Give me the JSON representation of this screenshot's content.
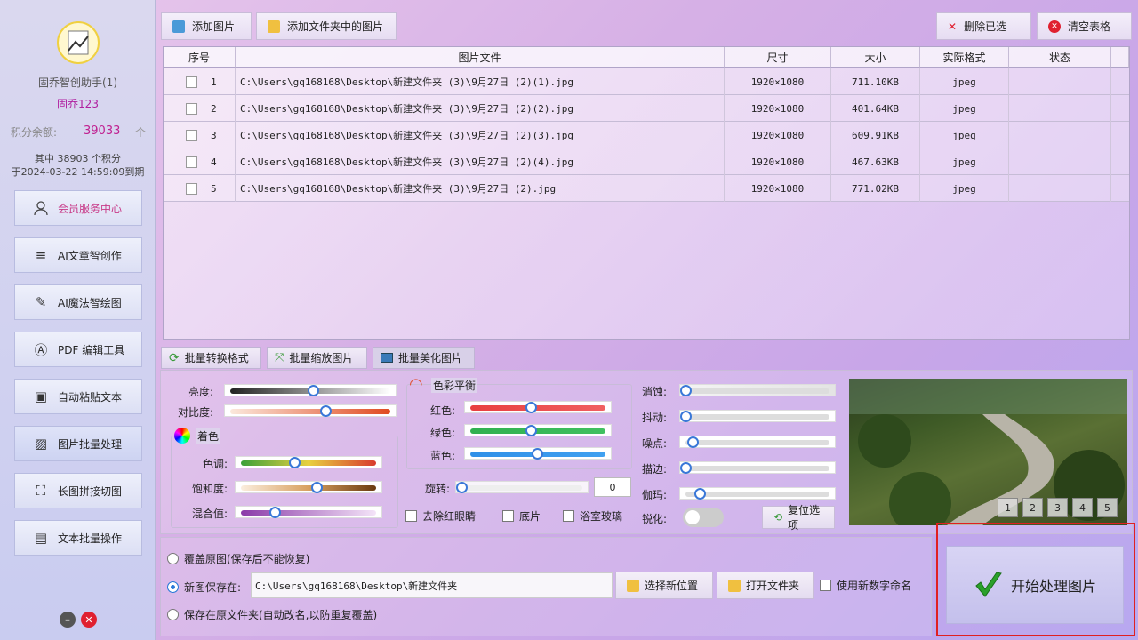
{
  "sidebar": {
    "username": "固乔智创助手(1)",
    "nickname": "固乔123",
    "points_label": "积分余额:",
    "points_value": "39033",
    "points_unit": "个",
    "expire_line1": "其中 38903 个积分",
    "expire_line2": "于2024-03-22 14:59:09到期",
    "member_center": "会员服务中心",
    "menu": [
      "AI文章智创作",
      "AI魔法智绘图",
      "PDF 编辑工具",
      "自动粘贴文本",
      "图片批量处理",
      "长图拼接切图",
      "文本批量操作"
    ]
  },
  "toolbar": {
    "add_image": "添加图片",
    "add_folder": "添加文件夹中的图片",
    "delete_selected": "删除已选",
    "clear_table": "清空表格"
  },
  "table": {
    "headers": [
      "序号",
      "图片文件",
      "尺寸",
      "大小",
      "实际格式",
      "状态"
    ],
    "rows": [
      {
        "idx": "1",
        "file": "C:\\Users\\gq168168\\Desktop\\新建文件夹 (3)\\9月27日 (2)(1).jpg",
        "size": "1920×1080",
        "bytes": "711.10KB",
        "fmt": "jpeg",
        "status": ""
      },
      {
        "idx": "2",
        "file": "C:\\Users\\gq168168\\Desktop\\新建文件夹 (3)\\9月27日 (2)(2).jpg",
        "size": "1920×1080",
        "bytes": "401.64KB",
        "fmt": "jpeg",
        "status": ""
      },
      {
        "idx": "3",
        "file": "C:\\Users\\gq168168\\Desktop\\新建文件夹 (3)\\9月27日 (2)(3).jpg",
        "size": "1920×1080",
        "bytes": "609.91KB",
        "fmt": "jpeg",
        "status": ""
      },
      {
        "idx": "4",
        "file": "C:\\Users\\gq168168\\Desktop\\新建文件夹 (3)\\9月27日 (2)(4).jpg",
        "size": "1920×1080",
        "bytes": "467.63KB",
        "fmt": "jpeg",
        "status": ""
      },
      {
        "idx": "5",
        "file": "C:\\Users\\gq168168\\Desktop\\新建文件夹 (3)\\9月27日 (2).jpg",
        "size": "1920×1080",
        "bytes": "771.02KB",
        "fmt": "jpeg",
        "status": ""
      }
    ]
  },
  "tabs": [
    "批量转换格式",
    "批量缩放图片",
    "批量美化图片"
  ],
  "beautify": {
    "brightness": "亮度:",
    "contrast": "对比度:",
    "tint_group": "着色",
    "hue": "色调:",
    "saturation": "饱和度:",
    "blend": "混合值:",
    "balance_group": "色彩平衡",
    "red": "红色:",
    "green": "绿色:",
    "blue": "蓝色:",
    "rotate": "旋转:",
    "rotate_value": "0",
    "redeye": "去除红眼睛",
    "negative": "底片",
    "frosted": "浴室玻璃",
    "erode": "消蚀:",
    "jitter": "抖动:",
    "noise": "噪点:",
    "edge": "描边:",
    "gamma": "伽玛:",
    "sharpen": "锐化:",
    "reset": "复位选项",
    "levels": {
      "brightness": 0.52,
      "contrast": 0.6,
      "hue": 0.4,
      "saturation": 0.57,
      "blend": 0.25,
      "red": 0.45,
      "green": 0.45,
      "blue": 0.5,
      "rotate": 0.0,
      "erode": 0.0,
      "jitter": 0.0,
      "noise": 0.05,
      "edge": 0.0,
      "gamma": 0.1
    }
  },
  "preview": {
    "pages": [
      "1",
      "2",
      "3",
      "4",
      "5"
    ]
  },
  "save": {
    "overwrite": "覆盖原图(保存后不能恢复)",
    "new_location": "新图保存在:",
    "path": "C:\\Users\\gq168168\\Desktop\\新建文件夹",
    "choose": "选择新位置",
    "open": "打开文件夹",
    "numeric": "使用新数字命名",
    "keep": "保存在原文件夹(自动改名,以防重复覆盖)"
  },
  "start": "开始处理图片"
}
